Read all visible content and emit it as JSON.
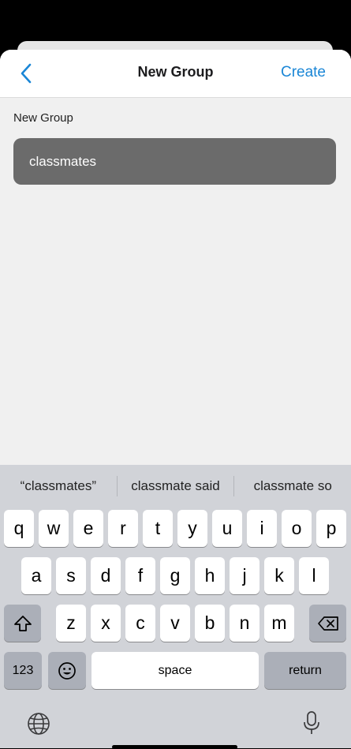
{
  "nav": {
    "title": "New Group",
    "create_label": "Create"
  },
  "form": {
    "section_label": "New Group",
    "group_name_value": "classmates"
  },
  "keyboard": {
    "suggestions": [
      "“classmates”",
      "classmate said",
      "classmate so"
    ],
    "row1": [
      "q",
      "w",
      "e",
      "r",
      "t",
      "y",
      "u",
      "i",
      "o",
      "p"
    ],
    "row2": [
      "a",
      "s",
      "d",
      "f",
      "g",
      "h",
      "j",
      "k",
      "l"
    ],
    "row3": [
      "z",
      "x",
      "c",
      "v",
      "b",
      "n",
      "m"
    ],
    "numbers_label": "123",
    "space_label": "space",
    "return_label": "return"
  },
  "colors": {
    "accent": "#1a86d6",
    "input_bg": "#6b6b6b",
    "keyboard_bg": "#d1d3d8"
  }
}
